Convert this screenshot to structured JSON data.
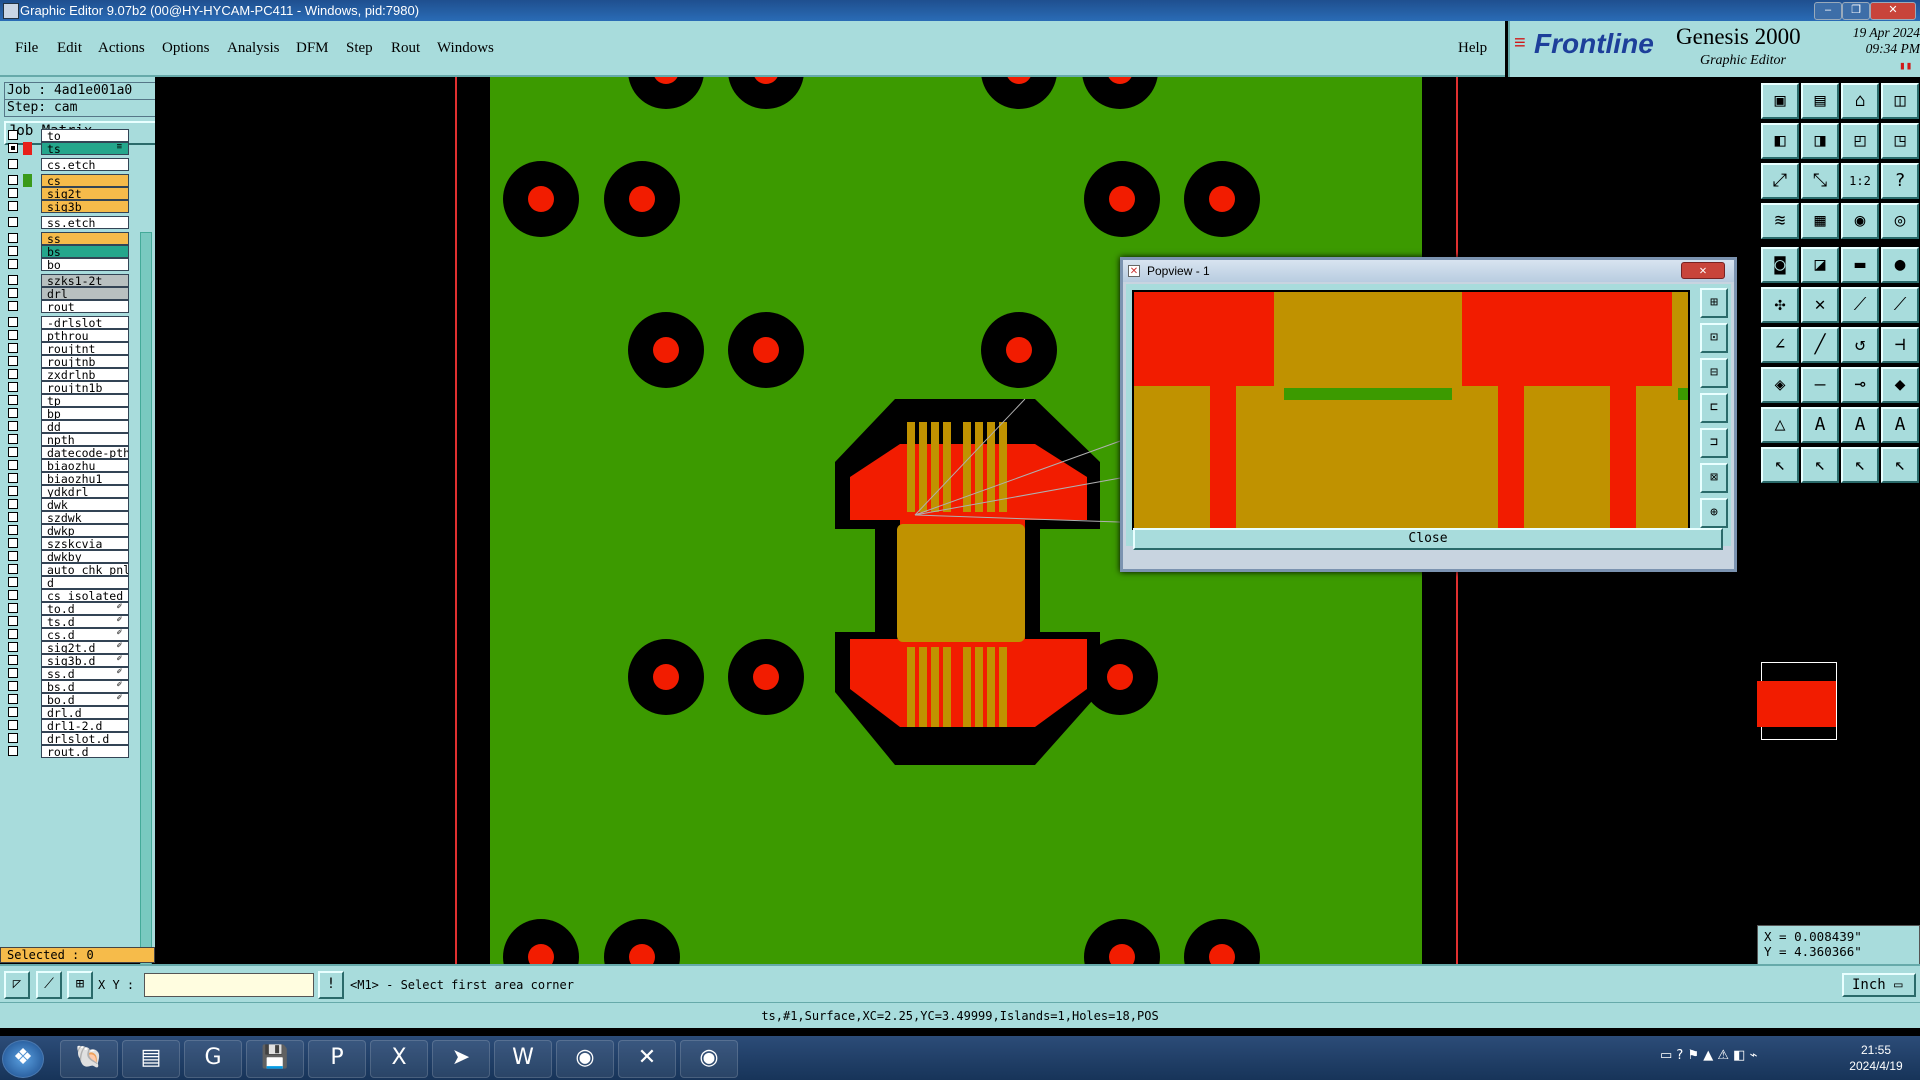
{
  "window": {
    "title": "Graphic Editor 9.07b2 (00@HY-HYCAM-PC411 - Windows, pid:7980)",
    "controls": [
      "–",
      "❐",
      "✕"
    ]
  },
  "menu": {
    "items": [
      "File",
      "Edit",
      "Actions",
      "Options",
      "Analysis",
      "DFM",
      "Step",
      "Rout",
      "Windows"
    ],
    "help": "Help"
  },
  "brand": {
    "logo": "Frontline",
    "product": "Genesis 2000",
    "subtitle": "Graphic Editor",
    "date": "19 Apr 2024",
    "time": "09:34 PM"
  },
  "job": {
    "job_label": "Job : 4ad1e001a0",
    "step_label": "Step: cam",
    "matrix_button": "Job Matrix ..."
  },
  "layers": [
    {
      "name": "to",
      "color": "#ffffff",
      "checked": false
    },
    {
      "name": "ts",
      "color": "#24a68c",
      "checked": true,
      "swatch": "#e8201a",
      "mark": "≡"
    },
    {
      "name": "cs.etch",
      "color": "#ffffff",
      "checked": false
    },
    {
      "name": "cs",
      "color": "#f6bb4a",
      "checked": false,
      "swatch": "#3a9a1a"
    },
    {
      "name": "sig2t",
      "color": "#f6bb4a",
      "checked": false
    },
    {
      "name": "sig3b",
      "color": "#f6bb4a",
      "checked": false
    },
    {
      "name": "ss.etch",
      "color": "#ffffff",
      "checked": false
    },
    {
      "name": "ss",
      "color": "#f6bb4a",
      "checked": false
    },
    {
      "name": "bs",
      "color": "#24a68c",
      "checked": false
    },
    {
      "name": "bo",
      "color": "#ffffff",
      "checked": false
    },
    {
      "name": "szks1-2t",
      "color": "#b8c0c0",
      "checked": false
    },
    {
      "name": "drl",
      "color": "#b8c0c0",
      "checked": false
    },
    {
      "name": "rout",
      "color": "#ffffff",
      "checked": false
    },
    {
      "name": "-drlslot",
      "color": "#ffffff",
      "checked": false
    },
    {
      "name": "pthrou",
      "color": "#ffffff",
      "checked": false
    },
    {
      "name": "roujtnt",
      "color": "#ffffff",
      "checked": false
    },
    {
      "name": "roujtnb",
      "color": "#ffffff",
      "checked": false
    },
    {
      "name": "zxdrlnb",
      "color": "#ffffff",
      "checked": false
    },
    {
      "name": "roujtn1b",
      "color": "#ffffff",
      "checked": false
    },
    {
      "name": "tp",
      "color": "#ffffff",
      "checked": false
    },
    {
      "name": "bp",
      "color": "#ffffff",
      "checked": false
    },
    {
      "name": "dd",
      "color": "#ffffff",
      "checked": false
    },
    {
      "name": "npth",
      "color": "#ffffff",
      "checked": false
    },
    {
      "name": "datecode-pth",
      "color": "#ffffff",
      "checked": false
    },
    {
      "name": "biaozhu",
      "color": "#ffffff",
      "checked": false
    },
    {
      "name": "biaozhu1",
      "color": "#ffffff",
      "checked": false
    },
    {
      "name": "ydkdrl",
      "color": "#ffffff",
      "checked": false
    },
    {
      "name": "dwk",
      "color": "#ffffff",
      "checked": false
    },
    {
      "name": "szdwk",
      "color": "#ffffff",
      "checked": false
    },
    {
      "name": "dwkp",
      "color": "#ffffff",
      "checked": false
    },
    {
      "name": "szskcvia",
      "color": "#ffffff",
      "checked": false
    },
    {
      "name": "dwkby",
      "color": "#ffffff",
      "checked": false
    },
    {
      "name": "auto_chk_pnl",
      "color": "#ffffff",
      "checked": false
    },
    {
      "name": "d",
      "color": "#ffffff",
      "checked": false
    },
    {
      "name": "cs_isolated",
      "color": "#ffffff",
      "checked": false
    },
    {
      "name": "to.d",
      "color": "#ffffff",
      "checked": false,
      "mark": "✐"
    },
    {
      "name": "ts.d",
      "color": "#ffffff",
      "checked": false,
      "mark": "✐"
    },
    {
      "name": "cs.d",
      "color": "#ffffff",
      "checked": false,
      "mark": "✐"
    },
    {
      "name": "sig2t.d",
      "color": "#ffffff",
      "checked": false,
      "mark": "✐"
    },
    {
      "name": "sig3b.d",
      "color": "#ffffff",
      "checked": false,
      "mark": "✐"
    },
    {
      "name": "ss.d",
      "color": "#ffffff",
      "checked": false,
      "mark": "✐"
    },
    {
      "name": "bs.d",
      "color": "#ffffff",
      "checked": false,
      "mark": "✐"
    },
    {
      "name": "bo.d",
      "color": "#ffffff",
      "checked": false,
      "mark": "✐"
    },
    {
      "name": "drl.d",
      "color": "#ffffff",
      "checked": false
    },
    {
      "name": "drl1-2.d",
      "color": "#ffffff",
      "checked": false
    },
    {
      "name": "drlslot.d",
      "color": "#ffffff",
      "checked": false
    },
    {
      "name": "rout.d",
      "color": "#ffffff",
      "checked": false
    }
  ],
  "selected_label": "Selected : 0",
  "popview": {
    "title": "Popview - 1",
    "close_label": "Close",
    "tool_icons": [
      "⊞",
      "⊡",
      "⊟",
      "⊏",
      "⊐",
      "⊠",
      "⊕"
    ]
  },
  "toolbox_icons": [
    "▣",
    "▤",
    "⌂",
    "◫",
    "◧",
    "◨",
    "◰",
    "◳",
    "⤢",
    "⤡",
    "1:2",
    "?",
    "≋",
    "▦",
    "◉",
    "◎",
    "◙",
    "◪",
    "▬",
    "●",
    "✣",
    "✕",
    "⟋",
    "⟋",
    "∠",
    "╱",
    "↺",
    "⊣",
    "◈",
    "—",
    "⊸",
    "◆",
    "△",
    "A",
    "A",
    "A",
    "↖",
    "↖",
    "↖",
    "↖"
  ],
  "coords": {
    "x": "X = 0.008439\"",
    "y": "Y = 4.360366\""
  },
  "command": {
    "xy_label": "X Y :",
    "prompt": "<M1> - Select first area corner",
    "unit": "Inch ▭"
  },
  "info": "ts,#1,Surface,XC=2.25,YC=3.49999,Islands=1,Holes=18,POS",
  "taskbar": {
    "apps": [
      "❖",
      "🐚",
      "▤",
      "G",
      "💾",
      "P",
      "X",
      "➤",
      "W",
      "◉",
      "✕",
      "◉"
    ],
    "time": "21:55",
    "date": "2024/4/19",
    "tray": "▭ ? ⚑ ▲ ⚠ ◧ ⌁"
  },
  "colors": {
    "panel": "#a8dcdc",
    "board": "#3c9a00",
    "copper": "#f21c00",
    "gold": "#c09200",
    "orange": "#f6bb4a",
    "teal": "#24a68c"
  }
}
